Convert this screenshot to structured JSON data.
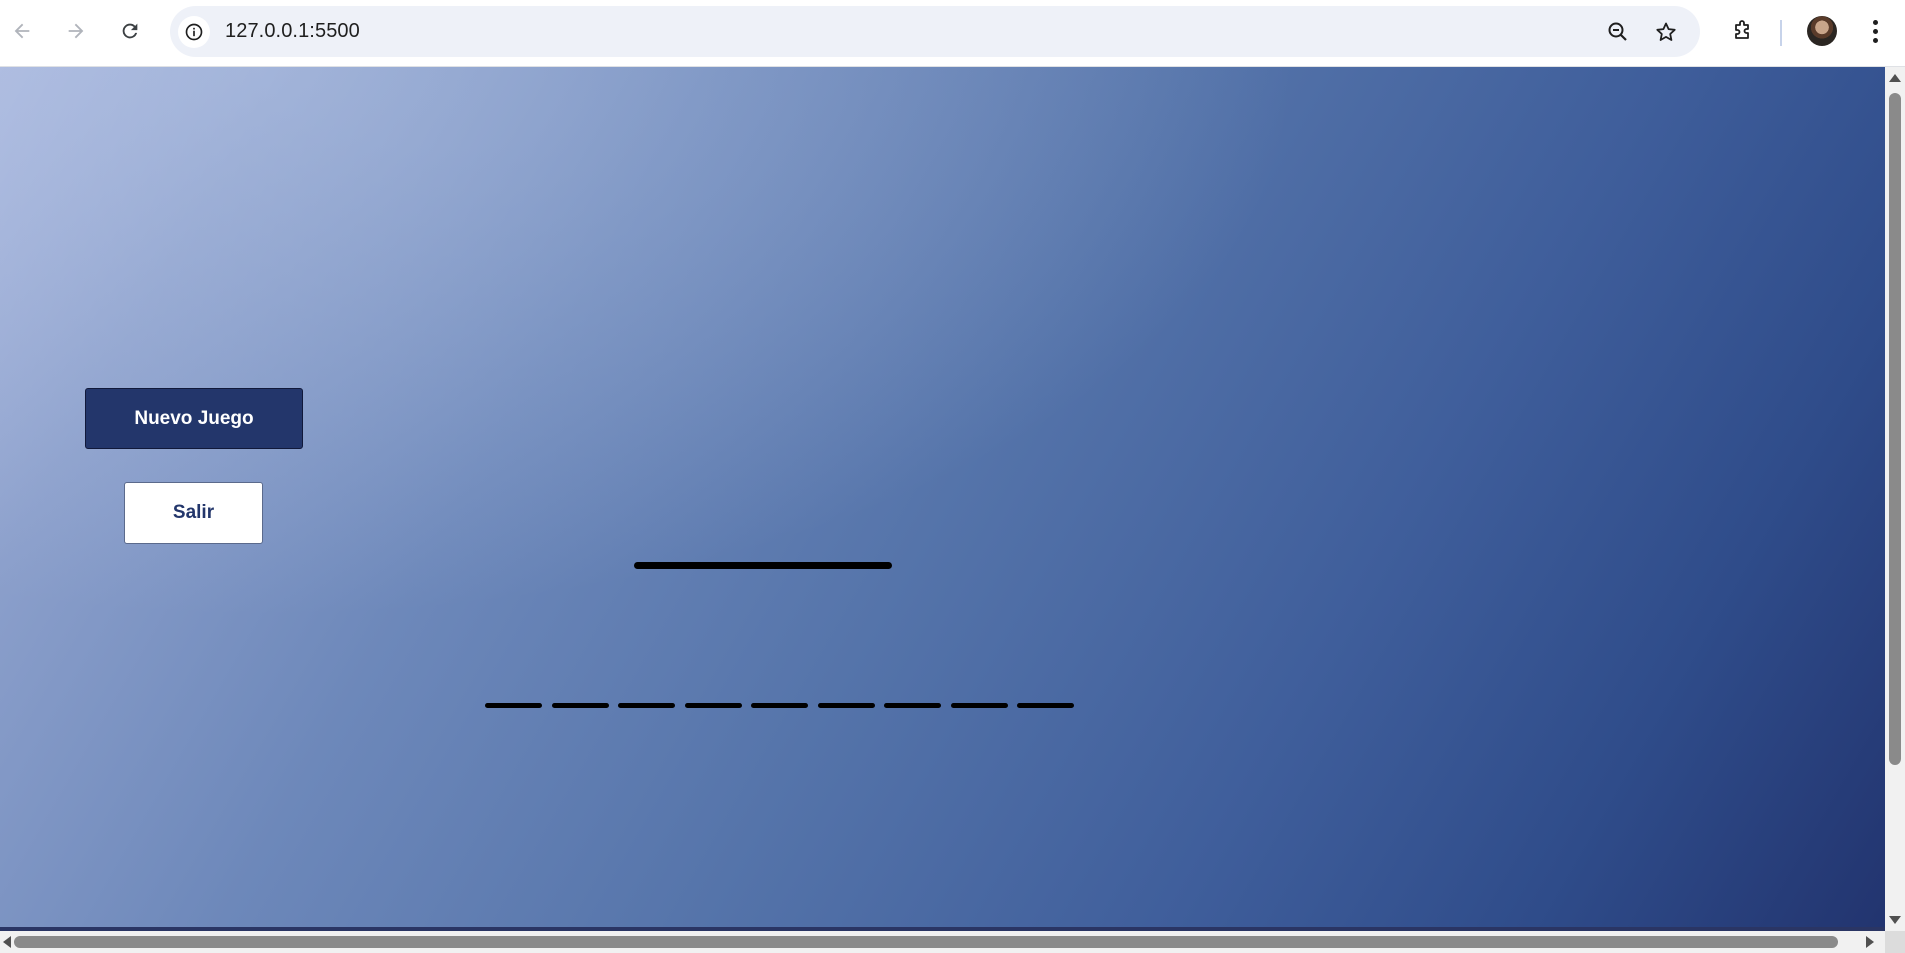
{
  "browser": {
    "url": "127.0.0.1:5500",
    "icons": {
      "back": "back-arrow-icon",
      "forward": "forward-arrow-icon",
      "reload": "reload-icon",
      "site_info": "info-icon",
      "zoom": "zoom-out-icon",
      "bookmark": "star-icon",
      "extensions": "puzzle-icon",
      "profile": "avatar",
      "menu": "kebab-menu-icon"
    }
  },
  "game": {
    "buttons": {
      "new_game": "Nuevo Juego",
      "exit": "Salir"
    },
    "word_slots": [
      "",
      "",
      "",
      "",
      "",
      "",
      "",
      "",
      ""
    ],
    "colors": {
      "primary_button": "#23366b",
      "secondary_button": "#ffffff",
      "background_start": "#a7b5dc",
      "background_end": "#22346f"
    }
  }
}
